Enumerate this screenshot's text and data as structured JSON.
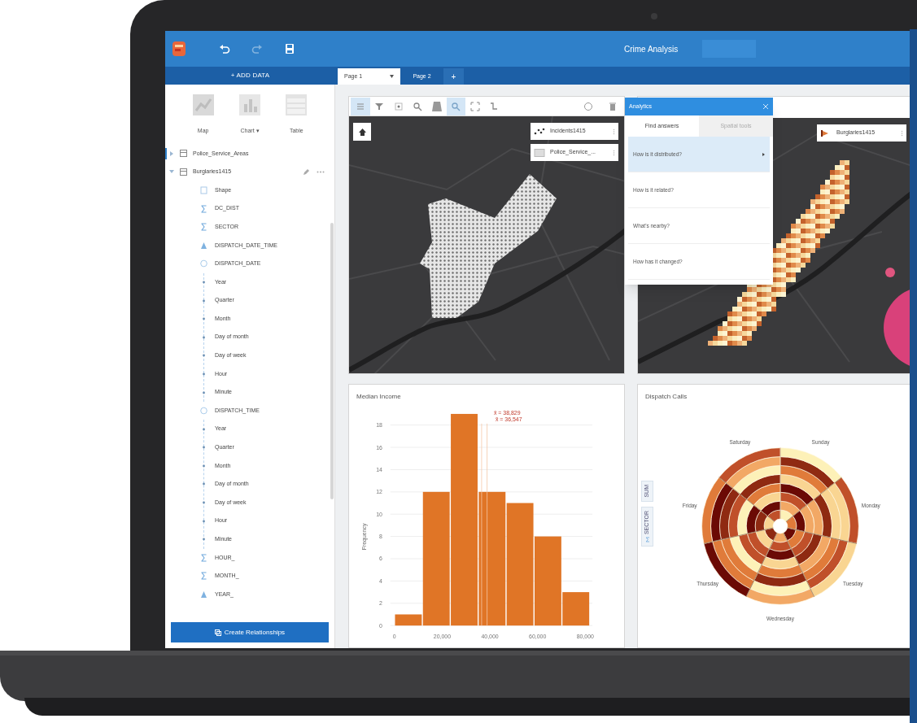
{
  "header": {
    "title": "Crime Analysis",
    "tools": [
      {
        "kind": "undo",
        "disabled": false
      },
      {
        "kind": "redo",
        "disabled": true
      },
      {
        "kind": "save",
        "disabled": false
      }
    ]
  },
  "add_data": "+ ADD DATA",
  "page_tabs": [
    {
      "label": "Page 1",
      "selected": true
    },
    {
      "label": "Page 2",
      "selected": false
    }
  ],
  "new_page": "+",
  "sidebar": {
    "add_buttons": [
      {
        "kind": "map",
        "label": "Map"
      },
      {
        "kind": "chart",
        "label": "Chart ▾"
      },
      {
        "kind": "table",
        "label": "Table"
      }
    ],
    "datasets": [
      {
        "name": "Police_Service_Areas",
        "expanded": false
      },
      {
        "name": "Burglaries1415",
        "expanded": true,
        "fields": [
          {
            "kind": "location",
            "name": "Shape"
          },
          {
            "kind": "number",
            "name": "DC_DIST"
          },
          {
            "kind": "number",
            "name": "SECTOR"
          },
          {
            "kind": "rate",
            "name": "DISPATCH_DATE_TIME"
          },
          {
            "kind": "date",
            "name": "DISPATCH_DATE",
            "children": [
              {
                "name": "Year"
              },
              {
                "name": "Quarter"
              },
              {
                "name": "Month"
              },
              {
                "name": "Day of month"
              },
              {
                "name": "Day of week"
              },
              {
                "name": "Hour"
              },
              {
                "name": "Minute"
              }
            ]
          },
          {
            "kind": "date",
            "name": "DISPATCH_TIME",
            "children": [
              {
                "name": "Year"
              },
              {
                "name": "Quarter"
              },
              {
                "name": "Month"
              },
              {
                "name": "Day of month"
              },
              {
                "name": "Day of week"
              },
              {
                "name": "Hour"
              },
              {
                "name": "Minute"
              }
            ]
          },
          {
            "kind": "number",
            "name": "HOUR_"
          },
          {
            "kind": "number",
            "name": "MONTH_"
          },
          {
            "kind": "rate",
            "name": "YEAR_"
          }
        ]
      }
    ],
    "create_button": "Create Relationships"
  },
  "map_card": {
    "tools": [
      {
        "kind": "legend",
        "active": true
      },
      {
        "kind": "filter",
        "active": false
      },
      {
        "kind": "select",
        "active": false
      },
      {
        "kind": "zoom",
        "active": false
      },
      {
        "kind": "basemap",
        "active": false
      },
      {
        "kind": "search",
        "active": true
      },
      {
        "kind": "extent",
        "active": false
      },
      {
        "kind": "link",
        "active": false
      }
    ],
    "right_tools": [
      {
        "kind": "info"
      },
      {
        "kind": "delete"
      }
    ],
    "legend": [
      {
        "kind": "points",
        "label": "Incidents1415"
      },
      {
        "kind": "areas",
        "label": "Police_Service_..."
      }
    ]
  },
  "analytics": {
    "title": "Analytics",
    "tabs": [
      {
        "label": "Find answers",
        "selected": true
      },
      {
        "label": "Spatial tools",
        "selected": false
      }
    ],
    "items": [
      {
        "label": "How is it distributed?",
        "selected": true
      },
      {
        "label": "How is it related?",
        "selected": false
      },
      {
        "label": "What's nearby?",
        "selected": false
      },
      {
        "label": "How has it changed?",
        "selected": false
      }
    ]
  },
  "hexbin_card": {
    "legend": [
      {
        "kind": "bins",
        "label": "Burglaries1415"
      }
    ]
  },
  "histogram_card": {
    "title": "Median Income",
    "chart_data": {
      "type": "bar",
      "ylabel": "Frequency",
      "x": [
        5850,
        17550,
        29250,
        40950,
        52650,
        64350,
        76050
      ],
      "values": [
        1,
        12,
        19,
        12,
        11,
        8,
        3
      ],
      "xlim": [
        0,
        82000
      ],
      "ylim": [
        0,
        19
      ],
      "grid": true,
      "xticks": [
        {
          "value": 0,
          "label": "0"
        },
        {
          "value": 20000,
          "label": "20,000"
        },
        {
          "value": 40000,
          "label": "40,000"
        },
        {
          "value": 60000,
          "label": "60,000"
        },
        {
          "value": 80000,
          "label": "80,000"
        }
      ],
      "yticks": [
        0,
        2,
        4,
        6,
        8,
        10,
        12,
        14,
        16,
        18
      ],
      "ref_lines": [
        {
          "axis": "x",
          "value": 38829
        },
        {
          "axis": "x",
          "value": 36547
        }
      ],
      "annotations": [
        {
          "text": "x̄ = 38,829"
        },
        {
          "text": "x̃ = 36,547"
        }
      ]
    }
  },
  "radial_card": {
    "title": "Dispatch Calls",
    "side_buttons": [
      {
        "kind": "sum",
        "label": "SUM"
      },
      {
        "kind": "field",
        "label": "SECTOR"
      }
    ],
    "labels": [
      "Sunday",
      "Monday",
      "Tuesday",
      "Wednesday",
      "Thursday",
      "Friday",
      "Saturday"
    ]
  }
}
